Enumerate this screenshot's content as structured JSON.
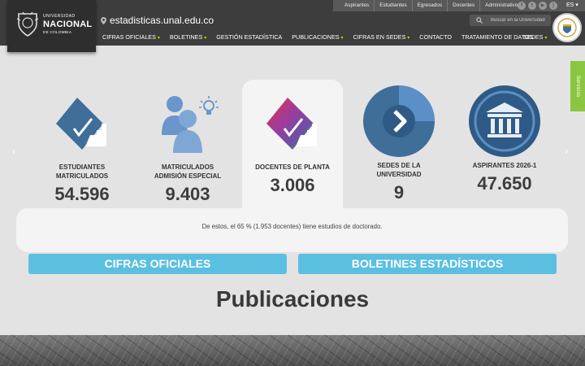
{
  "logo": {
    "line1": "UNIVERSIDAD",
    "line2": "NACIONAL",
    "line3": "DE COLOMBIA"
  },
  "top_links": [
    "Aspirantes",
    "Estudiantes",
    "Egresados",
    "Docentes",
    "Administrativos"
  ],
  "social_icons": [
    "facebook-icon",
    "twitter-icon",
    "youtube-icon",
    "rss-icon"
  ],
  "language": "ES",
  "url": "estadisticas.unal.edu.co",
  "search": {
    "placeholder": "Buscar en la Universidad"
  },
  "nav": [
    {
      "label": "CIFRAS OFICIALES",
      "dropdown": true
    },
    {
      "label": "BOLETINES",
      "dropdown": true
    },
    {
      "label": "GESTIÓN ESTADÍSTICA",
      "dropdown": false
    },
    {
      "label": "PUBLICACIONES",
      "dropdown": true
    },
    {
      "label": "CIFRAS EN SEDES",
      "dropdown": true
    },
    {
      "label": "CONTACTO",
      "dropdown": false
    },
    {
      "label": "TRATAMIENTO DE DATOS",
      "dropdown": false
    }
  ],
  "sedes_label": "SEDES",
  "services_tab": "Servicios",
  "stats": [
    {
      "label": "ESTUDIANTES MATRICULADOS",
      "value": "54.596"
    },
    {
      "label": "MATRICULADOS ADMISIÓN ESPECIAL",
      "value": "9.403"
    },
    {
      "label": "DOCENTES DE PLANTA",
      "value": "3.006"
    },
    {
      "label": "SEDES DE LA UNIVERSIDAD",
      "value": "9"
    },
    {
      "label": "ASPIRANTES 2026-1",
      "value": "47.650"
    }
  ],
  "info_text": "De estos, el 65 % (1.953 docentes) tiene estudios de doctorado.",
  "buttons": {
    "official": "CIFRAS OFICIALES",
    "bulletins": "BOLETINES ESTADÍSTICOS"
  },
  "publications_title": "Publicaciones",
  "colors": {
    "header": "#3d3d3d",
    "accent_green": "#8ac640",
    "button_blue": "#5bbfe0",
    "icon_blue": "#3f6e99",
    "nav_caret": "#c8d400"
  }
}
